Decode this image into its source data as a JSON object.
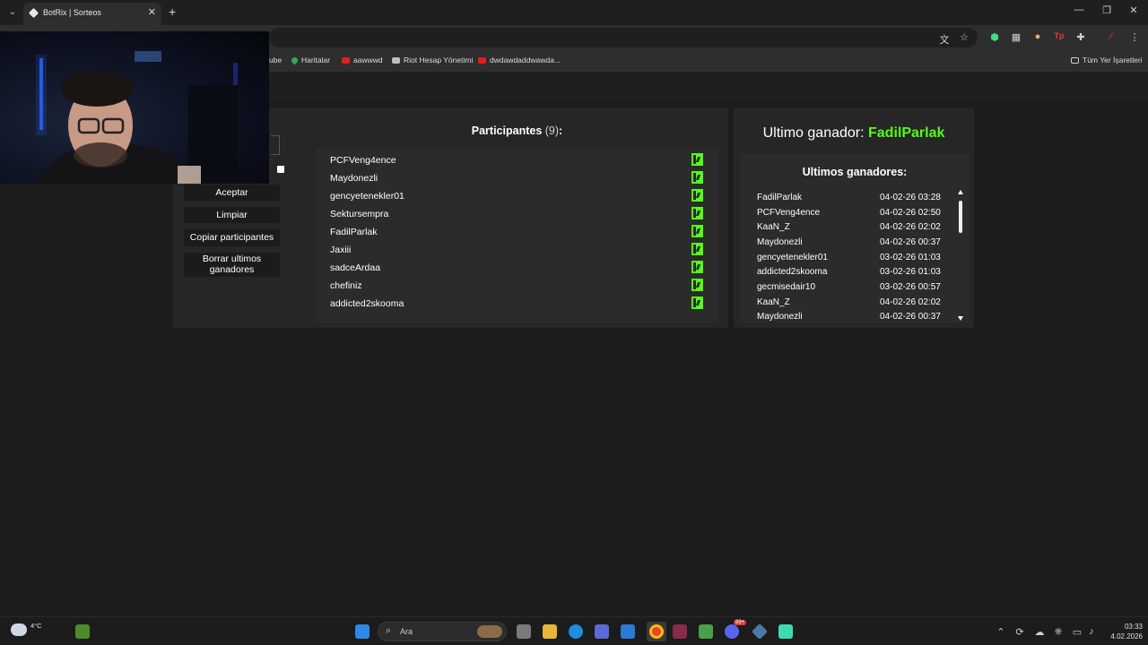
{
  "browser": {
    "tab_title": "BotRix | Sorteos",
    "tab_close": "✕",
    "new_tab": "+",
    "dropdown": "⌄",
    "window_controls": {
      "minimize": "—",
      "maximize": "❐",
      "close": "✕"
    },
    "bookmarks": [
      {
        "label": "ube",
        "icon": "youtube-icon"
      },
      {
        "label": "Haritalar",
        "icon": "maps-pin-icon"
      },
      {
        "label": "aawwwd",
        "icon": "youtube-icon"
      },
      {
        "label": "Riot Hesap Yönetimi",
        "icon": "riot-icon"
      },
      {
        "label": "dwdawdaddwawda...",
        "icon": "youtube-icon"
      }
    ],
    "all_bookmarks_label": "Tüm Yer İşaretleri"
  },
  "giveaway": {
    "buttons": {
      "accept": "Aceptar",
      "clear": "Limpiar",
      "copy_participants": "Copiar participantes",
      "clear_last_winners_line1": "Borrar ultimos",
      "clear_last_winners_line2": "ganadores"
    },
    "participants_label": "Participantes",
    "participants_count": "(9)",
    "participants_colon": ":",
    "participants": [
      "PCFVeng4ence",
      "Maydonezli",
      "gencyetenekler01",
      "Sektursempra",
      "FadilParlak",
      "Jaxiii",
      "sadceArdaa",
      "chefiniz",
      "addicted2skooma"
    ],
    "last_winner_label": "Ultimo ganador: ",
    "last_winner_name": "FadilParlak",
    "last_winners_title": "Ultimos ganadores:",
    "last_winners": [
      {
        "name": "FadilParlak",
        "date": "04-02-26 03:28"
      },
      {
        "name": "PCFVeng4ence",
        "date": "04-02-26 02:50"
      },
      {
        "name": "KaaN_Z",
        "date": "04-02-26 02:02"
      },
      {
        "name": "Maydonezli",
        "date": "04-02-26 00:37"
      },
      {
        "name": "gencyetenekler01",
        "date": "03-02-26 01:03"
      },
      {
        "name": "addicted2skooma",
        "date": "03-02-26 01:03"
      },
      {
        "name": "gecmisedair10",
        "date": "03-02-26 00:57"
      },
      {
        "name": "KaaN_Z",
        "date": "04-02-26 02:02"
      },
      {
        "name": "Maydonezli",
        "date": "04-02-26 00:37"
      }
    ]
  },
  "colors": {
    "kick_green": "#53fc18",
    "panel": "#262626",
    "list": "#2b2b2b"
  },
  "taskbar": {
    "search_label": "Ara",
    "weather_temp": "4°C",
    "time": "03:33",
    "date": "4.02.2026",
    "notification_count": "99+"
  }
}
